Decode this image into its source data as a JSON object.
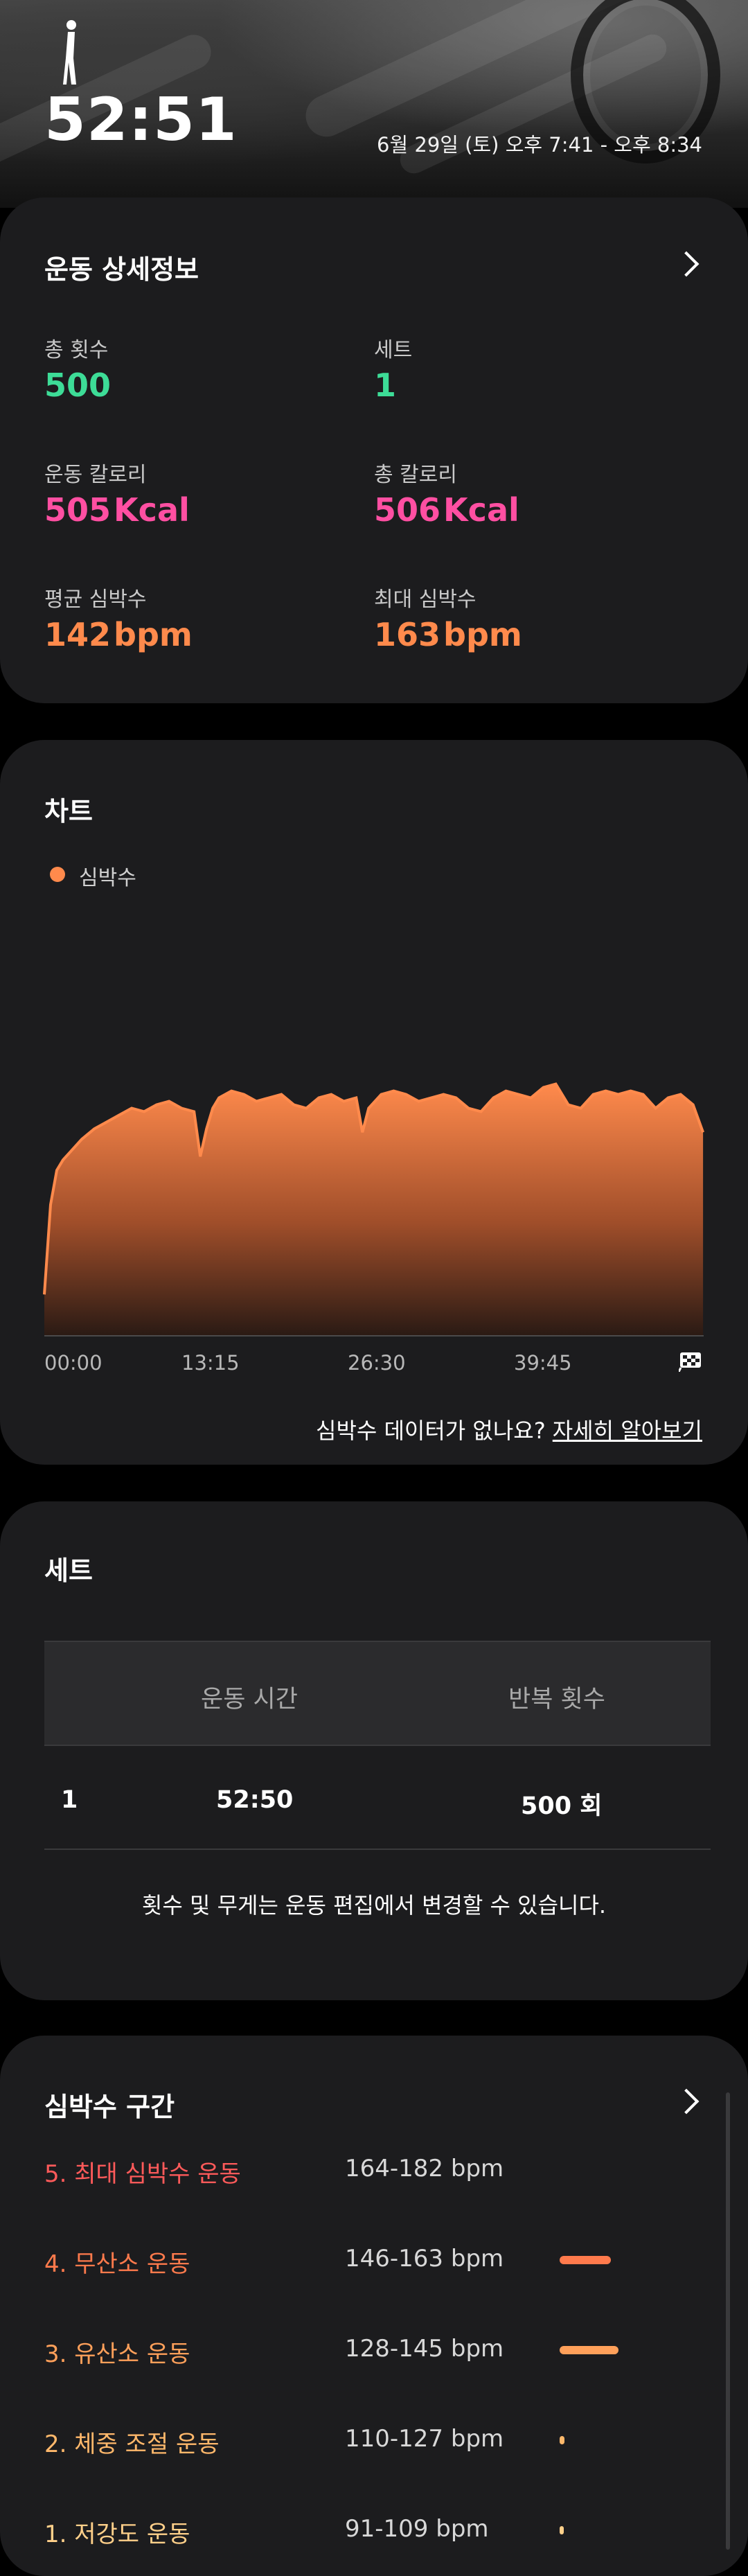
{
  "header": {
    "duration": "52:51",
    "date_range": "6월 29일 (토) 오후 7:41 - 오후 8:34",
    "icon": "person-figure-icon"
  },
  "details": {
    "title": "운동 상세정보",
    "stats": [
      {
        "label": "총 횟수",
        "value": "500",
        "unit": "",
        "color": "#3ddc97"
      },
      {
        "label": "세트",
        "value": "1",
        "unit": "",
        "color": "#3ddc97"
      },
      {
        "label": "운동 칼로리",
        "value": "505",
        "unit": "Kcal",
        "color": "#ff4fa2"
      },
      {
        "label": "총 칼로리",
        "value": "506",
        "unit": "Kcal",
        "color": "#ff4fa2"
      },
      {
        "label": "평균 심박수",
        "value": "142",
        "unit": "bpm",
        "color": "#ff8a4c"
      },
      {
        "label": "최대 심박수",
        "value": "163",
        "unit": "bpm",
        "color": "#ff8a4c"
      }
    ]
  },
  "chart_card": {
    "title": "차트",
    "legend": "심박수",
    "missing_text": "심박수 데이터가 없나요?",
    "missing_link": "자세히 알아보기"
  },
  "chart_data": {
    "type": "area",
    "title": "",
    "xlabel": "",
    "ylabel": "",
    "series": [
      {
        "name": "심박수",
        "color": "#ff8a4c",
        "x": [
          0,
          0.5,
          1,
          1.5,
          2,
          3,
          4,
          5,
          6,
          7,
          8,
          9,
          10,
          11,
          12,
          12.5,
          13,
          13.5,
          14,
          15,
          16,
          17,
          18,
          19,
          20,
          21,
          22,
          23,
          24,
          25,
          25.5,
          26,
          27,
          28,
          29,
          30,
          31,
          32,
          33,
          34,
          35,
          36,
          37,
          38,
          39,
          40,
          41,
          42,
          43,
          44,
          45,
          46,
          47,
          48,
          49,
          50,
          51,
          52,
          52.8
        ],
        "y": [
          92,
          118,
          128,
          131,
          133,
          137,
          140,
          142,
          144,
          146,
          145,
          147,
          148,
          146,
          145,
          132,
          140,
          146,
          149,
          151,
          150,
          148,
          149,
          150,
          147,
          146,
          149,
          150,
          148,
          149,
          139,
          146,
          150,
          151,
          150,
          148,
          149,
          150,
          149,
          146,
          145,
          149,
          151,
          150,
          149,
          152,
          153,
          147,
          146,
          150,
          151,
          150,
          151,
          150,
          146,
          149,
          150,
          147,
          139
        ]
      }
    ],
    "x_tick_labels": [
      "00:00",
      "13:15",
      "26:30",
      "39:45"
    ],
    "x_range": [
      0,
      52.85
    ],
    "y_range": [
      80,
      170
    ],
    "grid": false,
    "legend_position": "top-left"
  },
  "sets": {
    "title": "세트",
    "columns": [
      "운동 시간",
      "반복 횟수"
    ],
    "rows": [
      {
        "index": "1",
        "time": "52:50",
        "reps": "500 회"
      }
    ],
    "note": "횟수 및 무게는 운동 편집에서 변경할 수 있습니다."
  },
  "zones": {
    "title": "심박수 구간",
    "items": [
      {
        "label": "5. 최대 심박수 운동",
        "range": "164-182 bpm",
        "color": "#ff5a5a",
        "share": 0
      },
      {
        "label": "4. 무산소 운동",
        "range": "146-163 bpm",
        "color": "#ff7a4c",
        "share": 0.41
      },
      {
        "label": "3. 유산소 운동",
        "range": "128-145 bpm",
        "color": "#ffa05a",
        "share": 0.47
      },
      {
        "label": "2. 체중 조절 운동",
        "range": "110-127 bpm",
        "color": "#ffb86b",
        "share": 0.04
      },
      {
        "label": "1. 저강도 운동",
        "range": "91-109 bpm",
        "color": "#ffd08a",
        "share": 0.01
      }
    ]
  }
}
